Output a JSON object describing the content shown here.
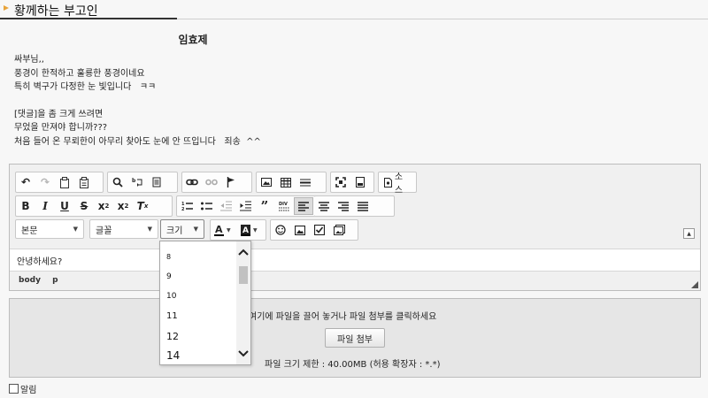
{
  "header": {
    "title": "황께하는 부고인"
  },
  "article": {
    "author": "임효제",
    "lines": [
      "싸부님,,",
      "풍경이 한적하고 훌룡한 풍경이네요",
      "특히 벽구가 다정한 눈 빛입니다   ㅋㅋ",
      "",
      "[댓글]을 좀 크게 쓰려면",
      "무었을 만져야 합니까???",
      "처음 들어 온 무뢰한이 아무리 찾아도 눈에 안 뜨입니다   죄송  ^^"
    ]
  },
  "editor": {
    "source_label": "소스",
    "format_combo": "본문",
    "font_combo": "글꼴",
    "size_combo": "크기",
    "content": "안녕하세요?",
    "path": [
      "body",
      "p"
    ],
    "size_options": [
      "8",
      "9",
      "10",
      "11",
      "12",
      "14"
    ]
  },
  "attachments": {
    "hint": "여기에 파일을 끌어 놓거나 파일 첨부를 클릭하세요",
    "button_label": "파일 첨부",
    "limit": "파일 크기 제한 : 40.00MB (허용 확장자 : *.*)"
  },
  "notify": {
    "label": "알림",
    "checked": false
  },
  "colors": {
    "accent_bullet": "#e8a33a",
    "title_underline": "#333333"
  }
}
